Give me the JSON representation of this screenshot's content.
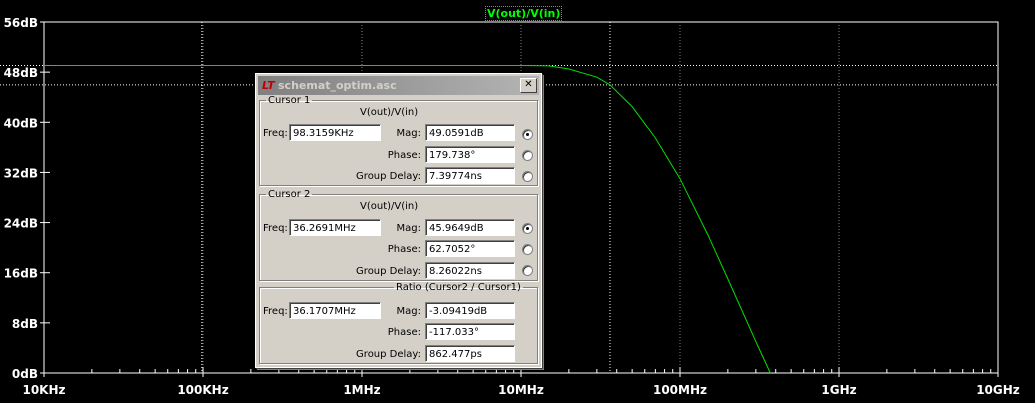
{
  "colors": {
    "background": "#000000",
    "trace": "#00e000",
    "grid": "#808080",
    "text": "#ffffff",
    "label_green": "#00ff00"
  },
  "plot": {
    "trace_label": "V(out)/V(in)"
  },
  "chart_data": {
    "type": "line",
    "xscale": "log",
    "xlim": [
      10000,
      10000000000
    ],
    "ylim": [
      0,
      56
    ],
    "yticks": [
      "0dB",
      "8dB",
      "16dB",
      "24dB",
      "32dB",
      "40dB",
      "48dB",
      "56dB"
    ],
    "xticks": [
      "10KHz",
      "100KHz",
      "1MHz",
      "10MHz",
      "100MHz",
      "1GHz",
      "10GHz"
    ],
    "series": [
      {
        "name": "V(out)/V(in)",
        "x": [
          10000,
          100000,
          1000000,
          10000000,
          15000000,
          20000000,
          30000000,
          36270000,
          50000000,
          70000000,
          100000000,
          150000000,
          200000000,
          300000000,
          370000000
        ],
        "y": [
          49.06,
          49.06,
          49.06,
          49.06,
          49.0,
          48.5,
          47.2,
          45.96,
          42.5,
          37.5,
          31.0,
          22.0,
          15.0,
          5.0,
          0.0
        ]
      }
    ],
    "cursors": [
      {
        "name": "Cursor 1",
        "x": 98315.9,
        "y": 49.0591
      },
      {
        "name": "Cursor 2",
        "x": 36269100,
        "y": 45.9649
      }
    ],
    "grid": true
  },
  "dialog": {
    "title": "schemat_optim.asc",
    "close": "✕",
    "cursor1": {
      "legend": "Cursor 1",
      "trace": "V(out)/V(in)",
      "freq_label": "Freq:",
      "freq": "98.3159KHz",
      "mag_label": "Mag:",
      "mag": "49.0591dB",
      "phase_label": "Phase:",
      "phase": "179.738°",
      "gd_label": "Group Delay:",
      "gd": "7.39774ns"
    },
    "cursor2": {
      "legend": "Cursor 2",
      "trace": "V(out)/V(in)",
      "freq_label": "Freq:",
      "freq": "36.2691MHz",
      "mag_label": "Mag:",
      "mag": "45.9649dB",
      "phase_label": "Phase:",
      "phase": "62.7052°",
      "gd_label": "Group Delay:",
      "gd": "8.26022ns"
    },
    "ratio": {
      "legend": "Ratio (Cursor2 / Cursor1)",
      "freq_label": "Freq:",
      "freq": "36.1707MHz",
      "mag_label": "Mag:",
      "mag": "-3.09419dB",
      "phase_label": "Phase:",
      "phase": "-117.033°",
      "gd_label": "Group Delay:",
      "gd": "862.477ps"
    }
  }
}
